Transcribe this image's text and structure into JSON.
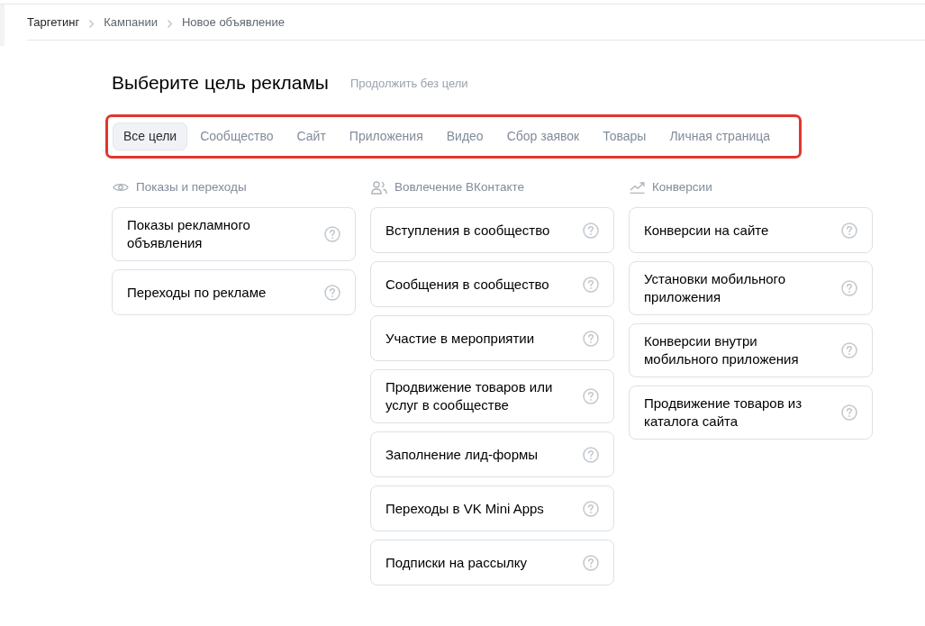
{
  "breadcrumbs": [
    "Таргетинг",
    "Кампании",
    "Новое объявление"
  ],
  "heading": "Выберите цель рекламы",
  "skip_link": "Продолжить без цели",
  "tabs": [
    {
      "label": "Все цели",
      "selected": true
    },
    {
      "label": "Сообщество",
      "selected": false
    },
    {
      "label": "Сайт",
      "selected": false
    },
    {
      "label": "Приложения",
      "selected": false
    },
    {
      "label": "Видео",
      "selected": false
    },
    {
      "label": "Сбор заявок",
      "selected": false
    },
    {
      "label": "Товары",
      "selected": false
    },
    {
      "label": "Личная страница",
      "selected": false
    }
  ],
  "columns": [
    {
      "title": "Показы и переходы",
      "goals": [
        "Показы рекламного объявления",
        "Переходы по рекламе"
      ]
    },
    {
      "title": "Вовлечение ВКонтакте",
      "goals": [
        "Вступления в сообщество",
        "Сообщения в сообщество",
        "Участие в мероприятии",
        "Продвижение товаров или услуг в сообществе",
        "Заполнение лид-формы",
        "Переходы в VK Mini Apps",
        "Подписки на рассылку"
      ]
    },
    {
      "title": "Конверсии",
      "goals": [
        "Конверсии на сайте",
        "Установки мобильного приложения",
        "Конверсии внутри мобильного приложения",
        "Продвижение товаров из каталога сайта"
      ]
    }
  ]
}
